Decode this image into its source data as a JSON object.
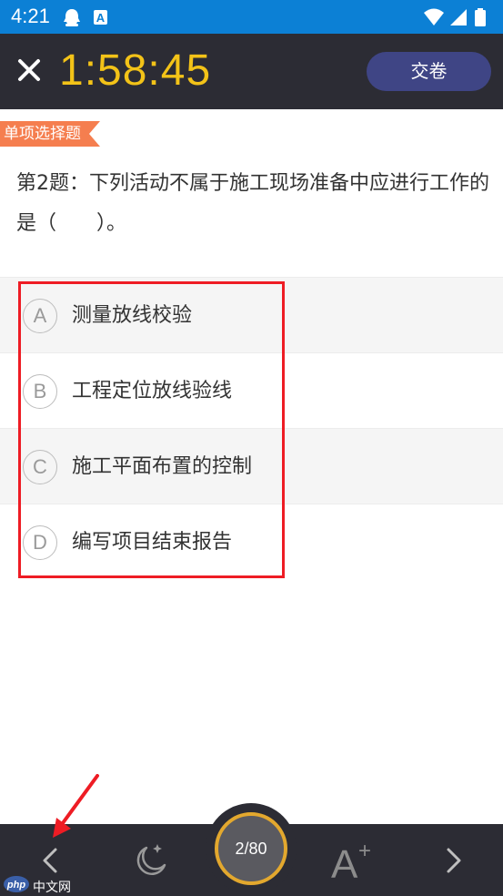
{
  "status_bar": {
    "time": "4:21"
  },
  "header": {
    "timer": "1:58:45",
    "submit_label": "交卷"
  },
  "question": {
    "type_label": "单项选择题",
    "text": "第2题：下列活动不属于施工现场准备中应进行工作的是（　　）。"
  },
  "options": [
    {
      "letter": "A",
      "text": "测量放线校验"
    },
    {
      "letter": "B",
      "text": "工程定位放线验线"
    },
    {
      "letter": "C",
      "text": "施工平面布置的控制"
    },
    {
      "letter": "D",
      "text": "编写项目结束报告"
    }
  ],
  "bottom_bar": {
    "progress": "2/80"
  },
  "watermark": {
    "logo": "php",
    "text": "中文网"
  },
  "colors": {
    "status_bar": "#0c80d5",
    "header_bg": "#2c2c34",
    "timer": "#f3c318",
    "submit_button": "#3f4585",
    "tag": "#f57e4f",
    "highlight": "#ee1c24",
    "progress_ring": "#e3a82e"
  }
}
